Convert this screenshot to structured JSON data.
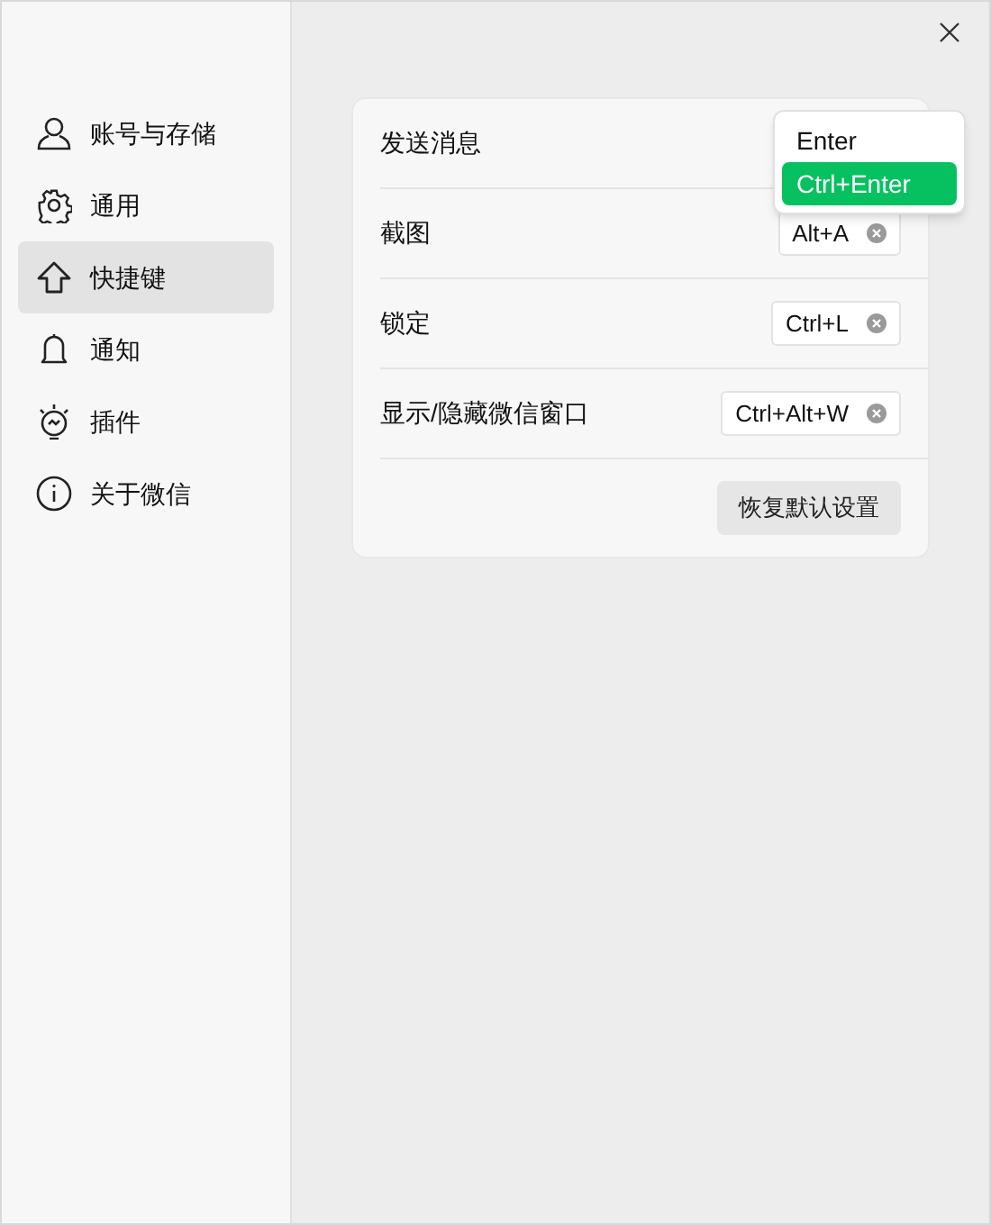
{
  "sidebar": {
    "items": [
      {
        "label": "账号与存储",
        "kind": "user",
        "selected": false
      },
      {
        "label": "通用",
        "kind": "gear",
        "selected": false
      },
      {
        "label": "快捷键",
        "kind": "shortcut",
        "selected": true
      },
      {
        "label": "通知",
        "kind": "bell",
        "selected": false
      },
      {
        "label": "插件",
        "kind": "plugin",
        "selected": false
      },
      {
        "label": "关于微信",
        "kind": "info",
        "selected": false
      }
    ]
  },
  "shortcuts": [
    {
      "label": "发送消息"
    },
    {
      "label": "截图",
      "value": "Alt+A"
    },
    {
      "label": "锁定",
      "value": "Ctrl+L"
    },
    {
      "label": "显示/隐藏微信窗口",
      "value": "Ctrl+Alt+W"
    }
  ],
  "restore_button": "恢复默认设置",
  "dropdown": {
    "options": [
      {
        "label": "Enter",
        "selected": false
      },
      {
        "label": "Ctrl+Enter",
        "selected": true
      }
    ]
  }
}
